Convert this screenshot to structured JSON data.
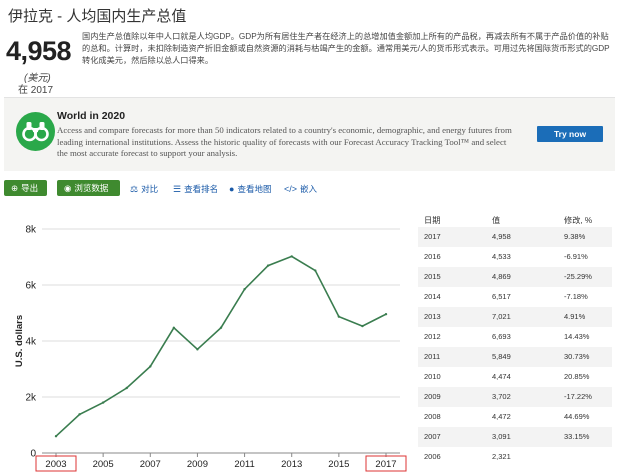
{
  "header": {
    "title": "伊拉克 - 人均国内生产总值",
    "big_value": "4,958",
    "unit": "(美元)",
    "year_text": "在 2017",
    "description": "国内生产总值除以年中人口就是人均GDP。GDP为所有居住生产者在经济上的总增加值金额加上所有的产品税，再减去所有不属于产品价值的补贴的总和。计算时，未扣除制造资产折旧金额或自然资源的消耗与枯竭产生的金额。通常用美元/人的货币形式表示。可用过先将国际货币形式的GDP转化成美元，然后除以总人口得来。"
  },
  "banner": {
    "title": "World in 2020",
    "text": "Access and compare forecasts for more than 50 indicators related to a country's economic, demographic, and energy futures from leading international institutions. Assess the historic quality of forecasts with our Forecast Accuracy Tracking Tool™ and select the most accurate forecast to support your analysis.",
    "button": "Try now",
    "icon": "binoculars-icon",
    "accent": "#2aa84a",
    "button_color": "#1b6db8"
  },
  "toolbar": {
    "export": "导出",
    "browse": "浏览数据",
    "compare": "对比",
    "ranking": "查看排名",
    "map": "查看地图",
    "embed": "嵌入",
    "button_color": "#3f8a2f",
    "link_color": "#1a5aa8"
  },
  "chart_data": {
    "type": "line",
    "x": [
      2003,
      2004,
      2005,
      2006,
      2007,
      2008,
      2009,
      2010,
      2011,
      2012,
      2013,
      2014,
      2015,
      2016,
      2017
    ],
    "values": [
      600,
      1380,
      1800,
      2321,
      3091,
      4472,
      3702,
      4474,
      5849,
      6693,
      7021,
      6517,
      4869,
      4533,
      4958
    ],
    "ylabel": "U.S. dollars",
    "ylim": [
      0,
      8000
    ],
    "yticks": [
      "0",
      "2k",
      "4k",
      "6k",
      "8k"
    ],
    "xticks": [
      "2003",
      "2005",
      "2007",
      "2009",
      "2011",
      "2013",
      "2015",
      "2017"
    ],
    "highlighted_xticks": [
      "2003",
      "2017"
    ],
    "grid": true,
    "line_color": "#3a7d4f"
  },
  "table": {
    "headers": [
      "日期",
      "值",
      "修改, %"
    ],
    "rows": [
      [
        "2017",
        "4,958",
        "9.38%"
      ],
      [
        "2016",
        "4,533",
        "-6.91%"
      ],
      [
        "2015",
        "4,869",
        "-25.29%"
      ],
      [
        "2014",
        "6,517",
        "-7.18%"
      ],
      [
        "2013",
        "7,021",
        "4.91%"
      ],
      [
        "2012",
        "6,693",
        "14.43%"
      ],
      [
        "2011",
        "5,849",
        "30.73%"
      ],
      [
        "2010",
        "4,474",
        "20.85%"
      ],
      [
        "2009",
        "3,702",
        "-17.22%"
      ],
      [
        "2008",
        "4,472",
        "44.69%"
      ],
      [
        "2007",
        "3,091",
        "33.15%"
      ],
      [
        "2006",
        "2,321",
        ""
      ]
    ]
  }
}
